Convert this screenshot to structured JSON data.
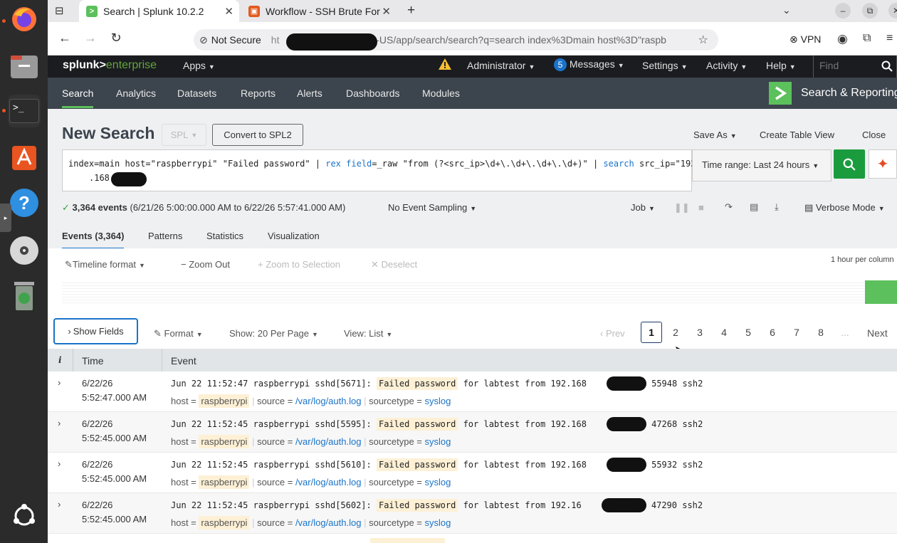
{
  "dock": {
    "terminal_glyph": ">_",
    "help_glyph": "?"
  },
  "tabs": [
    {
      "label": "Search | Splunk 10.2.2",
      "icon": "splunk-favicon"
    },
    {
      "label": "Workflow - SSH Brute For",
      "icon": "workflow-favicon"
    }
  ],
  "address": {
    "security_label": "Not Secure",
    "url_start": "ht",
    "url_visible": "n-US/app/search/search?q=search index%3Dmain host%3D\"raspb"
  },
  "browser_ext": {
    "vpn_label": "VPN"
  },
  "splunk_top": {
    "logo_a": "splunk>",
    "logo_b": "enterprise",
    "apps": "Apps",
    "admin": "Administrator",
    "messages_count": "5",
    "messages": "Messages",
    "settings": "Settings",
    "activity": "Activity",
    "help": "Help",
    "find_placeholder": "Find"
  },
  "splunk_nav": {
    "items": [
      "Search",
      "Analytics",
      "Datasets",
      "Reports",
      "Alerts",
      "Dashboards",
      "Modules"
    ],
    "app_name": "Search & Reporting"
  },
  "search": {
    "title": "New Search",
    "spl_label": "SPL",
    "convert_label": "Convert to SPL2",
    "save_as": "Save As",
    "create_table_view": "Create Table View",
    "close": "Close",
    "query_part1": "index=main host=\"raspberrypi\" \"Failed password\" | ",
    "query_rex": "rex",
    "query_space": " ",
    "query_field": "field",
    "query_part2": "=_raw \"from (?<src_ip>\\d+\\.\\d+\\.\\d+\\.\\d+)\"  | ",
    "query_search": "search",
    "query_part3": " src_ip=\"192",
    "query_line2": ".168",
    "time_range": "Time range: Last 24 hours"
  },
  "status": {
    "events_count": "3,364 events",
    "events_range": "(6/21/26 5:00:00.000 AM to 6/22/26 5:57:41.000 AM)",
    "sampling": "No Event Sampling",
    "job": "Job",
    "mode": "Verbose Mode"
  },
  "result_tabs": [
    "Events (3,364)",
    "Patterns",
    "Statistics",
    "Visualization"
  ],
  "timeline": {
    "format": "Timeline format",
    "zoom_out": "Zoom Out",
    "zoom_selection": "Zoom to Selection",
    "deselect": "Deselect",
    "scale": "1 hour per column"
  },
  "controls": {
    "show_fields": "Show Fields",
    "format": "Format",
    "per_page": "Show: 20 Per Page",
    "view": "View: List",
    "prev": "Prev",
    "pages": [
      "1",
      "2",
      "3",
      "4",
      "5",
      "6",
      "7",
      "8"
    ],
    "ellipsis": "...",
    "next": "Next"
  },
  "table": {
    "col_info": "i",
    "col_time": "Time",
    "col_event": "Event"
  },
  "events": [
    {
      "date": "6/22/26",
      "time": "5:52:47.000 AM",
      "pre": "Jun 22 11:52:47 raspberrypi sshd[5671]: ",
      "hl": "Failed password",
      "mid": " for labtest from 192.168",
      "post": "port 55948 ssh2",
      "host": "raspberrypi",
      "source": "/var/log/auth.log",
      "sourcetype": "syslog"
    },
    {
      "date": "6/22/26",
      "time": "5:52:45.000 AM",
      "pre": "Jun 22 11:52:45 raspberrypi sshd[5595]: ",
      "hl": "Failed password",
      "mid": " for labtest from 192.168",
      "post": "port 47268 ssh2",
      "host": "raspberrypi",
      "source": "/var/log/auth.log",
      "sourcetype": "syslog"
    },
    {
      "date": "6/22/26",
      "time": "5:52:45.000 AM",
      "pre": "Jun 22 11:52:45 raspberrypi sshd[5610]: ",
      "hl": "Failed password",
      "mid": " for labtest from 192.168",
      "post": "port 55932 ssh2",
      "host": "raspberrypi",
      "source": "/var/log/auth.log",
      "sourcetype": "syslog"
    },
    {
      "date": "6/22/26",
      "time": "5:52:45.000 AM",
      "pre": "Jun 22 11:52:45 raspberrypi sshd[5602]: ",
      "hl": "Failed password",
      "mid": " for labtest from 192.16",
      "post": "port 47290 ssh2",
      "host": "raspberrypi",
      "source": "/var/log/auth.log",
      "sourcetype": "syslog"
    }
  ],
  "meta_labels": {
    "host": "host =",
    "source": "source =",
    "sourcetype": "sourcetype ="
  }
}
